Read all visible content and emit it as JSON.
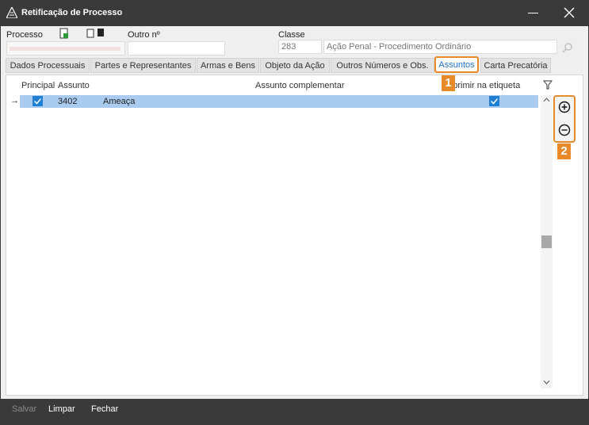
{
  "window": {
    "title": "Retificação de Processo"
  },
  "header": {
    "processo_label": "Processo",
    "outro_label": "Outro nº",
    "classe_label": "Classe",
    "classe_code": "283",
    "classe_desc": "Ação Penal - Procedimento Ordinário"
  },
  "tabs": [
    {
      "label": "Dados Processuais"
    },
    {
      "label": "Partes e Representantes"
    },
    {
      "label": "Armas e Bens"
    },
    {
      "label": "Objeto da Ação"
    },
    {
      "label": "Outros Números e Obs."
    },
    {
      "label": "Assuntos"
    },
    {
      "label": "Carta Precatória"
    }
  ],
  "table": {
    "columns": [
      "Principal",
      "Assunto",
      "Assunto complementar",
      "Imprimir na etiqueta"
    ],
    "rows": [
      {
        "principal": true,
        "codigo": "3402",
        "assunto": "Ameaça",
        "complementar": "",
        "imprimir": true
      }
    ]
  },
  "annotations": [
    "1",
    "2"
  ],
  "footer": {
    "salvar": "Salvar",
    "limpar": "Limpar",
    "fechar": "Fechar"
  },
  "colors": {
    "accent": "#1e7fd4",
    "highlight": "#e8892a",
    "row_selected": "#a8cbef"
  }
}
